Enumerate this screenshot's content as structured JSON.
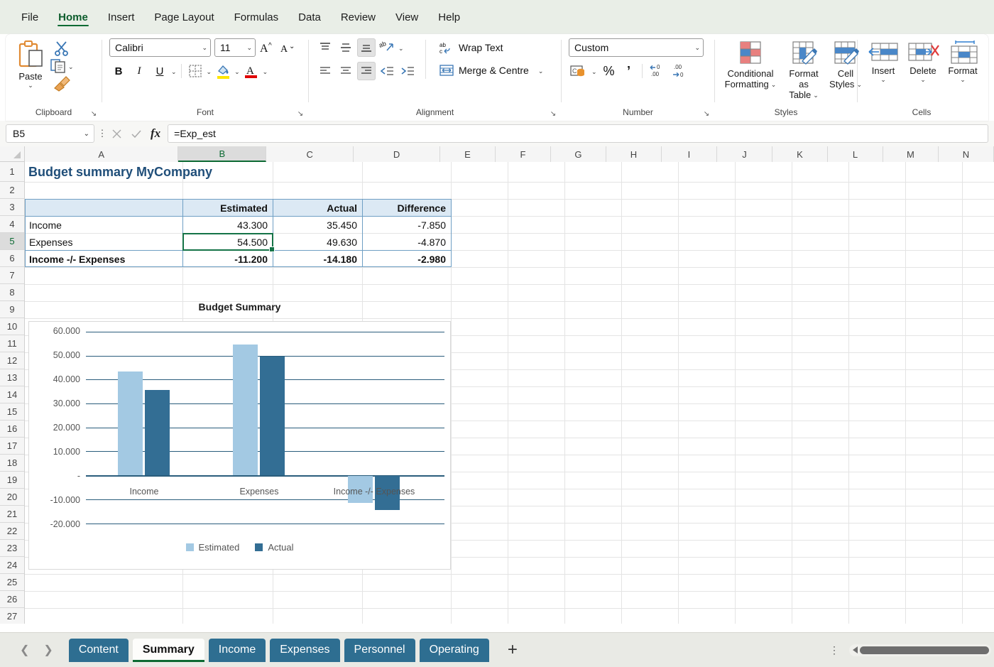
{
  "ribbon": {
    "tabs": [
      {
        "label": "File",
        "active": false
      },
      {
        "label": "Home",
        "active": true
      },
      {
        "label": "Insert",
        "active": false
      },
      {
        "label": "Page Layout",
        "active": false
      },
      {
        "label": "Formulas",
        "active": false
      },
      {
        "label": "Data",
        "active": false
      },
      {
        "label": "Review",
        "active": false
      },
      {
        "label": "View",
        "active": false
      },
      {
        "label": "Help",
        "active": false
      }
    ],
    "clipboard": {
      "group_label": "Clipboard",
      "paste_label": "Paste"
    },
    "font": {
      "group_label": "Font",
      "font_name": "Calibri",
      "font_size": "11"
    },
    "alignment": {
      "group_label": "Alignment",
      "wrap_text": "Wrap Text",
      "merge_centre": "Merge & Centre"
    },
    "number": {
      "group_label": "Number",
      "format": "Custom"
    },
    "styles": {
      "group_label": "Styles",
      "conditional_formatting": "Conditional\nFormatting",
      "conditional_formatting_l1": "Conditional",
      "conditional_formatting_l2": "Formatting",
      "format_as_table_l1": "Format as",
      "format_as_table_l2": "Table",
      "cell_styles_l1": "Cell",
      "cell_styles_l2": "Styles"
    },
    "cells": {
      "group_label": "Cells",
      "insert": "Insert",
      "delete": "Delete",
      "format": "Format"
    }
  },
  "formula_bar": {
    "name_box": "B5",
    "formula": "=Exp_est"
  },
  "grid": {
    "columns": [
      "A",
      "B",
      "C",
      "D",
      "E",
      "F",
      "G",
      "H",
      "I",
      "J",
      "K",
      "L",
      "M",
      "N"
    ],
    "selected_column": "B",
    "rows": [
      "1",
      "2",
      "3",
      "4",
      "5",
      "6",
      "7",
      "8",
      "9",
      "10",
      "11",
      "12",
      "13",
      "14",
      "15",
      "16",
      "17",
      "18",
      "19",
      "20",
      "21",
      "22",
      "23",
      "24",
      "25",
      "26",
      "27"
    ],
    "selected_row": "5",
    "title_cell": "Budget summary MyCompany",
    "table": {
      "headers": [
        "",
        "Estimated",
        "Actual",
        "Difference"
      ],
      "rows": [
        {
          "label": "Income",
          "estimated": "43.300",
          "actual": "35.450",
          "difference": "-7.850",
          "bold": false
        },
        {
          "label": "Expenses",
          "estimated": "54.500",
          "actual": "49.630",
          "difference": "-4.870",
          "bold": false
        },
        {
          "label": "Income -/- Expenses",
          "estimated": "-11.200",
          "actual": "-14.180",
          "difference": "-2.980",
          "bold": true
        }
      ]
    }
  },
  "chart_data": {
    "type": "bar",
    "title": "Budget Summary",
    "categories": [
      "Income",
      "Expenses",
      "Income -/- Expenses"
    ],
    "series": [
      {
        "name": "Estimated",
        "color": "#a3c9e3",
        "values": [
          43.3,
          54.5,
          -11.2
        ]
      },
      {
        "name": "Actual",
        "color": "#336e94",
        "values": [
          35.45,
          49.63,
          -14.18
        ]
      }
    ],
    "ylabel": "",
    "xlabel": "",
    "ylim": [
      -20,
      60
    ],
    "ytick_labels": [
      "60.000",
      "50.000",
      "40.000",
      "30.000",
      "20.000",
      "10.000",
      "-",
      "-10.000",
      "-20.000"
    ],
    "ytick_values": [
      60,
      50,
      40,
      30,
      20,
      10,
      0,
      -10,
      -20
    ],
    "grid": true,
    "legend_position": "bottom"
  },
  "sheet_bar": {
    "tabs": [
      {
        "label": "Content",
        "active": false
      },
      {
        "label": "Summary",
        "active": true
      },
      {
        "label": "Income",
        "active": false
      },
      {
        "label": "Expenses",
        "active": false
      },
      {
        "label": "Personnel",
        "active": false
      },
      {
        "label": "Operating",
        "active": false
      }
    ],
    "add_sheet": "+"
  }
}
